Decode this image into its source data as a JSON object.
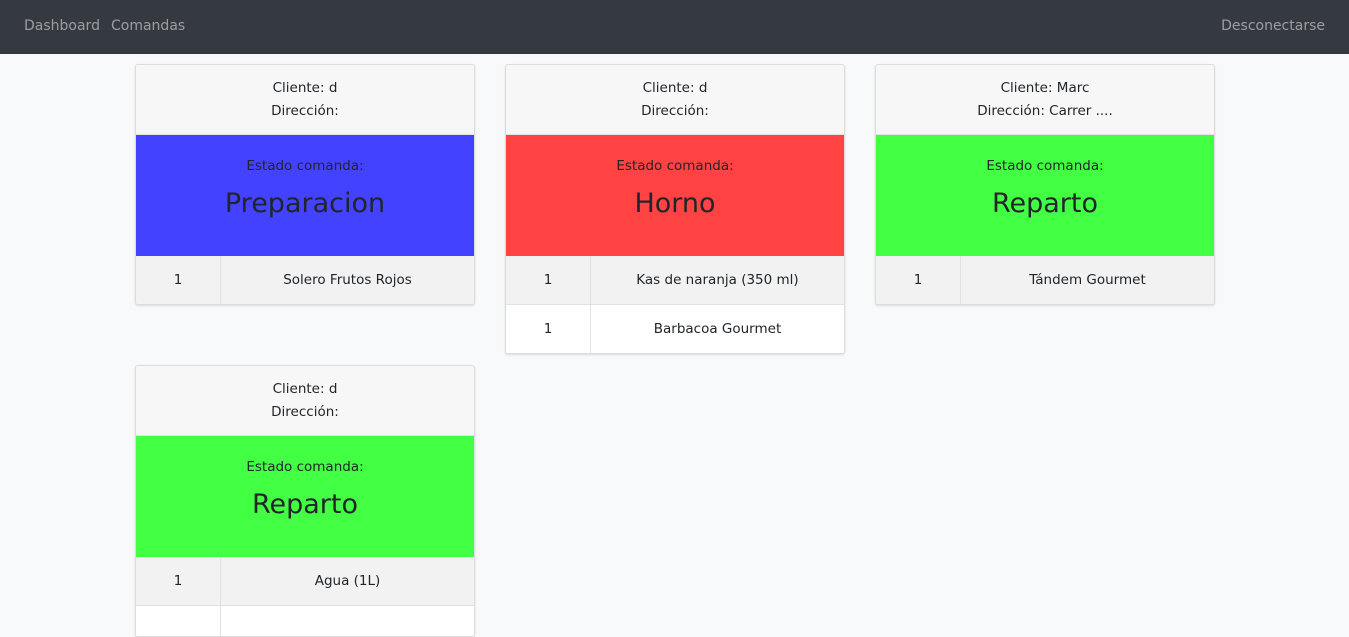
{
  "navbar": {
    "dashboard_label": "Dashboard",
    "comandas_label": "Comandas",
    "logout_label": "Desconectarse"
  },
  "colors": {
    "preparacion": "#4343ff",
    "horno": "#ff4343",
    "reparto": "#43ff43"
  },
  "orders": [
    {
      "cliente": "Cliente: d",
      "direccion": "Dirección:",
      "estado_label": "Estado comanda:",
      "estado": "Preparacion",
      "estado_color": "#4343ff",
      "items": [
        {
          "qty": "1",
          "name": "Solero Frutos Rojos"
        }
      ]
    },
    {
      "cliente": "Cliente: d",
      "direccion": "Dirección:",
      "estado_label": "Estado comanda:",
      "estado": "Horno",
      "estado_color": "#ff4343",
      "items": [
        {
          "qty": "1",
          "name": "Kas de naranja (350 ml)"
        },
        {
          "qty": "1",
          "name": "Barbacoa Gourmet"
        }
      ]
    },
    {
      "cliente": "Cliente: Marc",
      "direccion": "Dirección: Carrer ....",
      "estado_label": "Estado comanda:",
      "estado": "Reparto",
      "estado_color": "#43ff43",
      "items": [
        {
          "qty": "1",
          "name": "Tándem Gourmet"
        }
      ]
    },
    {
      "cliente": "Cliente: d",
      "direccion": "Dirección:",
      "estado_label": "Estado comanda:",
      "estado": "Reparto",
      "estado_color": "#43ff43",
      "items": [
        {
          "qty": "1",
          "name": "Agua (1L)"
        },
        {
          "qty": "",
          "name": ""
        }
      ]
    }
  ]
}
